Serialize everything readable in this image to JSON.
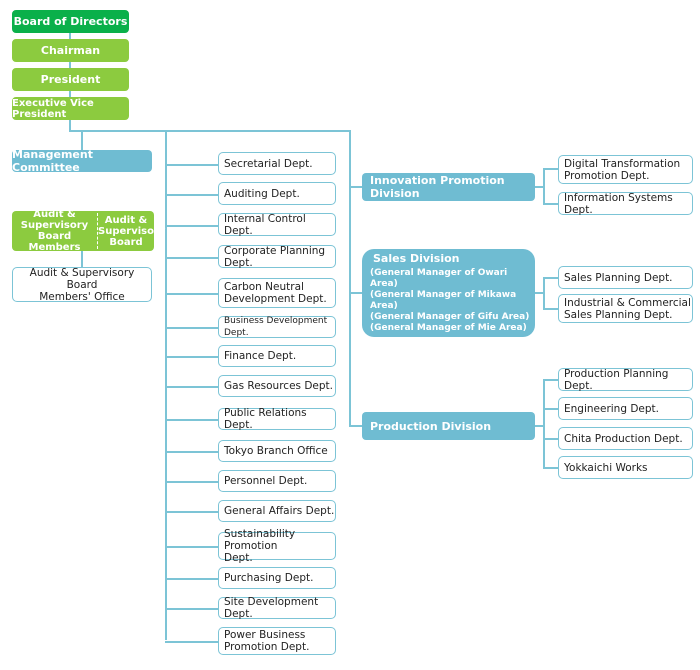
{
  "executives": {
    "board": "Board of Directors",
    "chairman": "Chairman",
    "president": "President",
    "evp": "Executive Vice President"
  },
  "management_committee": "Management Committee",
  "audit": {
    "members": "Audit &\nSupervisory\nBoard Members",
    "board": "Audit &\nSupervisory\nBoard",
    "office": "Audit & Supervisory Board\nMembers' Office"
  },
  "departments": [
    "Secretarial Dept.",
    "Auditing Dept.",
    "Internal Control Dept.",
    "Corporate Planning Dept.",
    "Carbon Neutral\n  Development Dept.",
    "Business Development Dept.",
    "Finance Dept.",
    "Gas Resources Dept.",
    "Public Relations Dept.",
    "Tokyo Branch Office",
    "Personnel Dept.",
    "General Affairs Dept.",
    "Sustainability Promotion\n  Dept.",
    "Purchasing Dept.",
    "Site Development Dept.",
    "Power Business\n  Promotion Dept."
  ],
  "divisions": {
    "innovation": {
      "label": "Innovation Promotion Division",
      "depts": [
        "Digital Transformation\n  Promotion Dept.",
        "Information Systems Dept."
      ]
    },
    "sales": {
      "label": "Sales Division",
      "managers": [
        "(General Manager of Owari Area)",
        "(General Manager of Mikawa Area)",
        "(General Manager of Gifu Area)",
        "(General Manager of Mie Area)"
      ],
      "depts": [
        "Sales Planning Dept.",
        "Industrial & Commercial\n  Sales Planning Dept."
      ]
    },
    "production": {
      "label": "Production Division",
      "depts": [
        "Production Planning Dept.",
        "Engineering Dept.",
        "Chita Production Dept.",
        "Yokkaichi Works"
      ]
    }
  },
  "colors": {
    "board": "#0ab04a",
    "executive": "#8ccb3f",
    "division": "#6fbcd2",
    "connector": "#7cc4d6"
  }
}
